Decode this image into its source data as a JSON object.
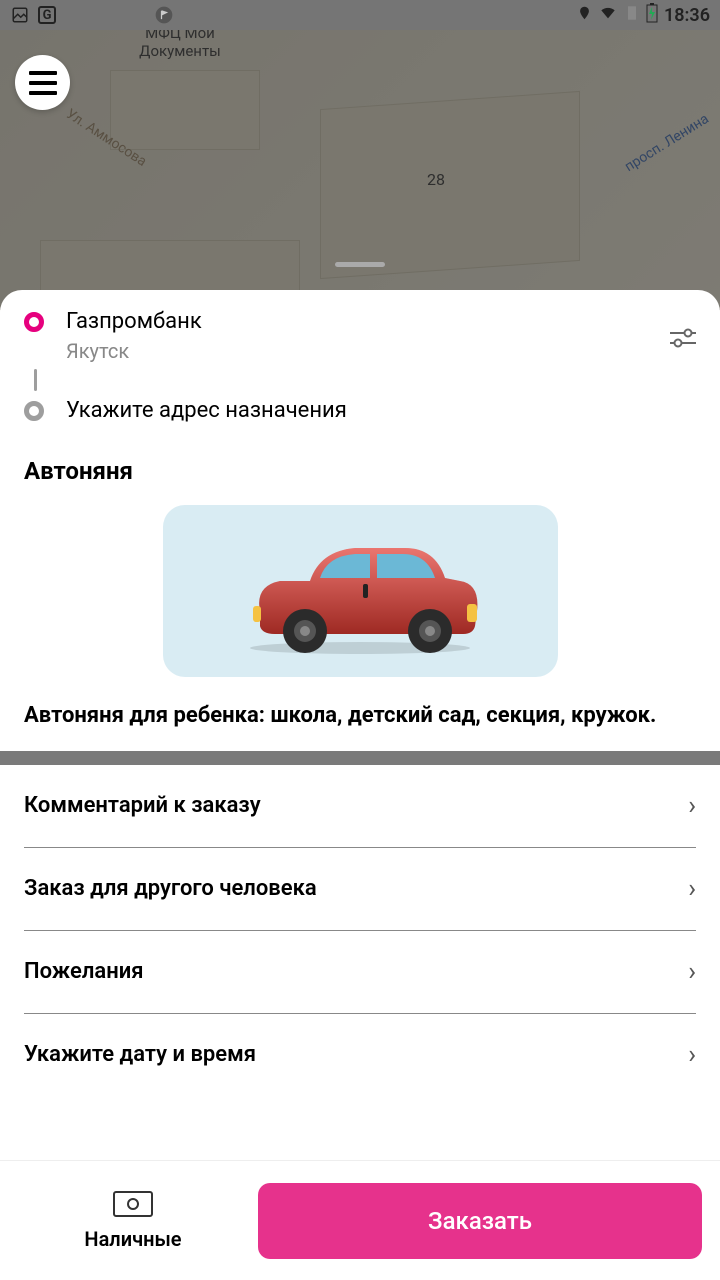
{
  "status": {
    "time": "18:36"
  },
  "map": {
    "poi_building": "МФЦ Мои Документы",
    "house_number": "28",
    "street1": "Ул. Аммосова",
    "street2": "просп. Ленина"
  },
  "pickup": {
    "title": "Газпромбанк",
    "city": "Якутск"
  },
  "dropoff": {
    "placeholder": "Укажите адрес назначения"
  },
  "service": {
    "name": "Автоняня",
    "description": "Автоняня для ребенка: школа, детский сад, секция, кружок."
  },
  "options": [
    {
      "label": "Комментарий к заказу"
    },
    {
      "label": "Заказ для другого человека"
    },
    {
      "label": "Пожелания"
    },
    {
      "label": "Укажите дату и время"
    }
  ],
  "payment": {
    "method": "Наличные"
  },
  "cta": {
    "order": "Заказать"
  }
}
